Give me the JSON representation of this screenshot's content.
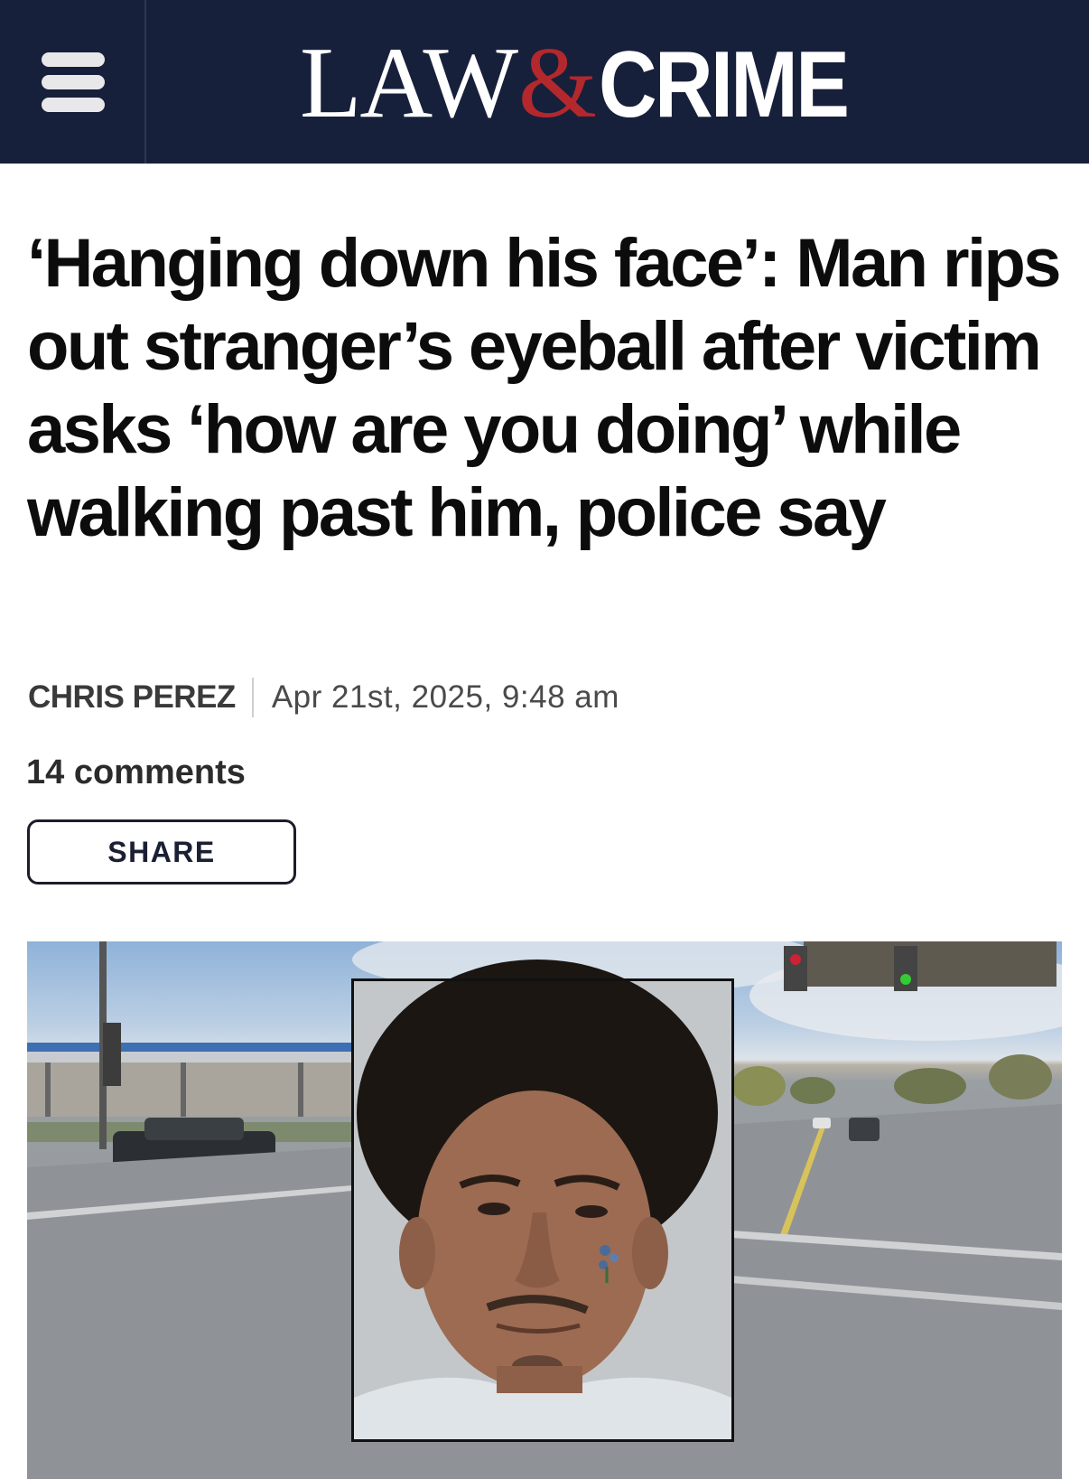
{
  "header": {
    "logo": {
      "law": "LAW",
      "amp": "&",
      "crime": "CRIME"
    },
    "menu_icon": "hamburger-menu-icon"
  },
  "article": {
    "headline": "‘Hanging down his face’: Man rips out stranger’s eyeball after victim asks ‘how are you doing’ while walking past him, police say",
    "author": "CHRIS PEREZ",
    "date": "Apr 21st, 2025, 9:48 am",
    "comments": "14 comments",
    "share_label": "SHARE"
  },
  "colors": {
    "header_bg": "#17203b",
    "logo_ampersand": "#b3282d",
    "text": "#0c0c0c"
  }
}
